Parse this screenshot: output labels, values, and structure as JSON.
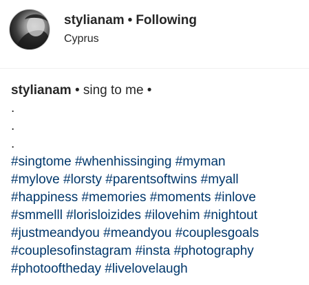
{
  "post_header": {
    "username": "stylianam",
    "separator": "•",
    "follow_status": "Following",
    "location": "Cyprus"
  },
  "caption": {
    "username": "stylianam",
    "text": "• sing to me •",
    "dots": [
      ".",
      ".",
      "."
    ],
    "hashtag_lines": [
      [
        "#singtome",
        "#whenhissinging",
        "#myman"
      ],
      [
        "#mylove",
        "#lorsty",
        "#parentsoftwins",
        "#myall"
      ],
      [
        "#happiness",
        "#memories",
        "#moments",
        "#inlove"
      ],
      [
        "#smmelll",
        "#lorisloizides",
        "#ilovehim",
        "#nightout"
      ],
      [
        "#justmeandyou",
        "#meandyou",
        "#couplesgoals"
      ],
      [
        "#couplesofinstagram",
        "#insta",
        "#photography"
      ],
      [
        "#photooftheday",
        "#livelovelaugh"
      ]
    ]
  },
  "colors": {
    "text": "#262626",
    "hashtag": "#00376b",
    "divider": "#efefef"
  }
}
